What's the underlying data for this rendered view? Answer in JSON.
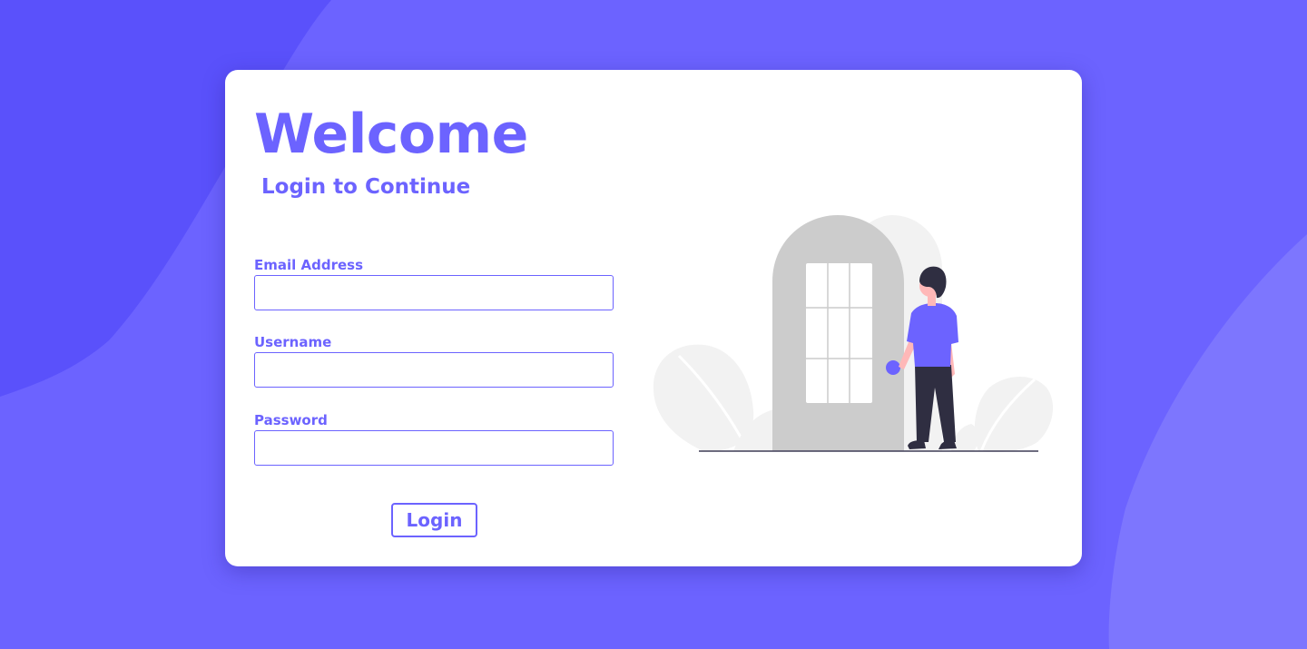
{
  "card": {
    "title": "Welcome",
    "subtitle": "Login to Continue"
  },
  "form": {
    "email": {
      "label": "Email Address",
      "value": "",
      "placeholder": ""
    },
    "username": {
      "label": "Username",
      "value": "",
      "placeholder": ""
    },
    "password": {
      "label": "Password",
      "value": "",
      "placeholder": ""
    },
    "login_label": "Login"
  },
  "icons": {
    "illustration": "person-at-door-illustration"
  },
  "colors": {
    "accent": "#6c63ff",
    "background": "#6c63ff",
    "card": "#ffffff",
    "door": "#cccccc",
    "foliage": "#f2f2f2",
    "pants": "#2f2e41"
  }
}
